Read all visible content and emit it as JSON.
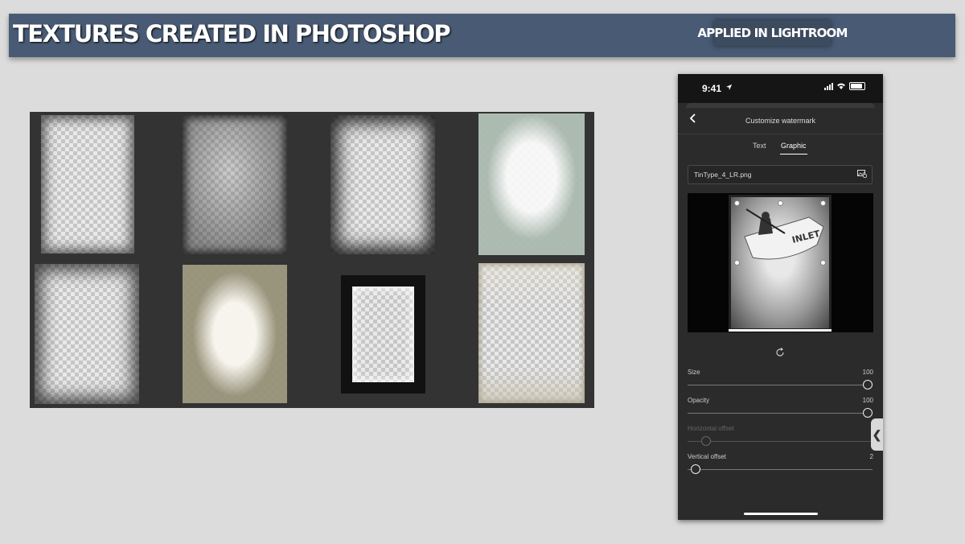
{
  "banner": {
    "title": "TEXTURES CREATED IN PHOTOSHOP",
    "tag": "APPLIED IN LIGHTROOM",
    "bg_color": "#485a74"
  },
  "textures": [
    {
      "name": "tintype-texture-1"
    },
    {
      "name": "tintype-texture-2"
    },
    {
      "name": "tintype-texture-3"
    },
    {
      "name": "tintype-texture-4"
    },
    {
      "name": "tintype-texture-5"
    },
    {
      "name": "tintype-texture-6"
    },
    {
      "name": "tintype-texture-7"
    },
    {
      "name": "tintype-texture-8"
    }
  ],
  "phone": {
    "status": {
      "time": "9:41"
    },
    "nav": {
      "back_icon": "chevron-left-icon",
      "title": "Customize watermark"
    },
    "tabs": [
      {
        "label": "Text",
        "active": false
      },
      {
        "label": "Graphic",
        "active": true
      }
    ],
    "file": {
      "name": "TinType_4_LR.png",
      "icon": "image-settings-icon"
    },
    "preview": {
      "boat_text": "INLET"
    },
    "sliders": {
      "size": {
        "label": "Size",
        "value": "100",
        "level": 1.0
      },
      "opacity": {
        "label": "Opacity",
        "value": "100",
        "level": 1.0
      },
      "horizontal_offset": {
        "label": "Horizontal offset",
        "value": "",
        "level": 0.08,
        "disabled": true
      },
      "vertical_offset": {
        "label": "Vertical offset",
        "value": "2",
        "level": 0.02
      }
    }
  }
}
